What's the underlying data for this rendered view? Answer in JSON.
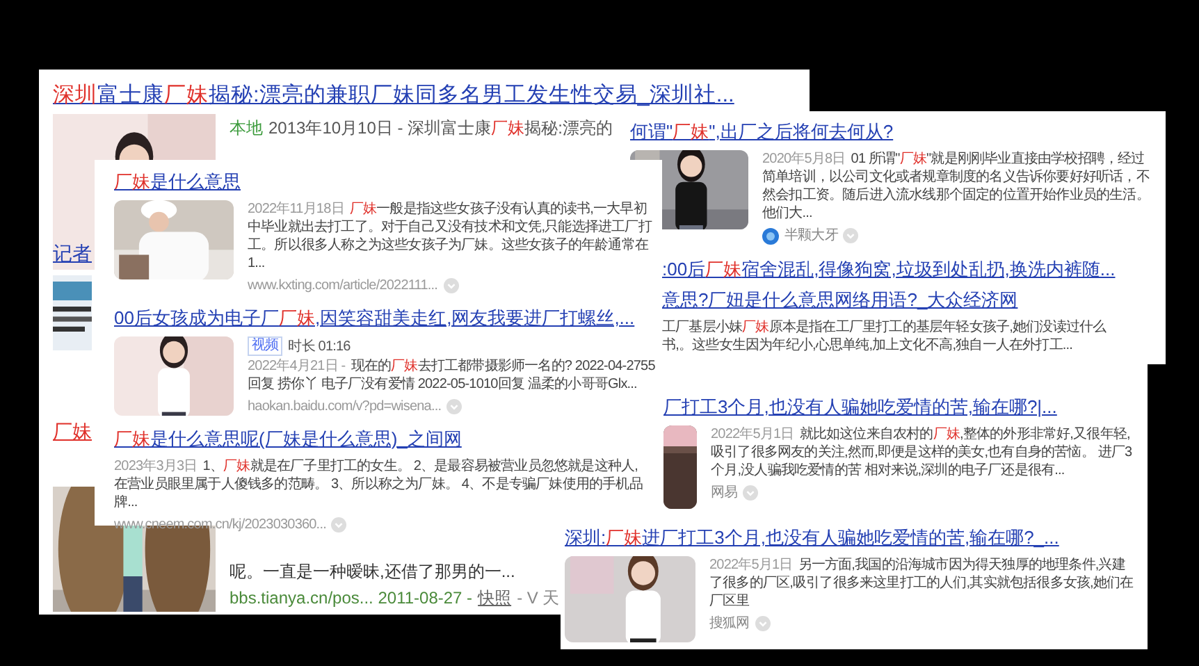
{
  "back_page": {
    "title": [
      {
        "text": "深圳",
        "highlight": true
      },
      {
        "text": "富士康",
        "highlight": false
      },
      {
        "text": "厂妹",
        "highlight": true
      },
      {
        "text": "揭秘:漂亮的兼职厂妹同多名男工发生性交易_深圳社...",
        "highlight": false
      }
    ],
    "thumbnail": {
      "kind": "picture"
    },
    "meta": {
      "tag": "本地",
      "text": [
        {
          "text": "2013年10月10日 - 深圳富士康",
          "highlight": false
        },
        {
          "text": "厂妹",
          "highlight": true
        },
        {
          "text": "揭秘:漂亮的",
          "highlight": false
        }
      ]
    },
    "fragment_1": "记者",
    "side_thumbnail": {
      "kind": "picture"
    },
    "fragment_2": "厂妹",
    "bottom_thumbnail": {
      "kind": "picture"
    },
    "snippet_end": "呢。一直是一种暧昧,还借了那男的一...",
    "footer": {
      "url": "bbs.tianya.cn/pos... 2011-08-27 -",
      "snapshot": "快照",
      "extra": "- V 天"
    }
  },
  "right_page": {
    "results": [
      {
        "title": [
          {
            "text": "何谓\"",
            "highlight": false
          },
          {
            "text": "厂妹",
            "highlight": true
          },
          {
            "text": "\",出厂之后将何去何从?",
            "highlight": false
          }
        ],
        "thumbnail": {
          "kind": "picture"
        },
        "date": "2020年5月8日",
        "snippet": [
          {
            "text": "01 所谓\"",
            "highlight": false
          },
          {
            "text": "厂妹",
            "highlight": true
          },
          {
            "text": "\"就是刚刚毕业直接由学校招聘，经过简单培训，以公司文化或者规章制度的名义告诉你要好好听话，不然会扣工资。随后进入流水线那个固定的位置开始作业员的生活。他们大...",
            "highlight": false
          }
        ],
        "source": "半颗大牙"
      },
      {
        "title": [
          {
            "text": ":00后",
            "highlight": false
          },
          {
            "text": "厂妹",
            "highlight": true
          },
          {
            "text": "宿舍混乱,得像狗窝,垃圾到处乱扔,换洗内裤随...",
            "highlight": false
          }
        ]
      },
      {
        "title": [
          {
            "text": "意思?厂妞是什么意思网络用语?_大众经济网",
            "highlight": false
          }
        ],
        "snippet": [
          {
            "text": "工厂基层小妹",
            "highlight": false
          },
          {
            "text": "厂妹",
            "highlight": true
          },
          {
            "text": "原本是指在工厂里打工的基层年轻女孩子,她们没读过什么书,。这些女生因为年纪小,心思单纯,加上文化不高,独自一人在外打工...",
            "highlight": false
          }
        ]
      }
    ]
  },
  "middle_page": {
    "results": [
      {
        "title": [
          {
            "text": "厂打工3个月,也没有人骗她吃爱情的苦,输在哪?|...",
            "highlight": false
          }
        ],
        "thumbnail": {
          "kind": "picture"
        },
        "date": "2022年5月1日",
        "snippet": [
          {
            "text": "就比如这位来自农村的",
            "highlight": false
          },
          {
            "text": "厂妹",
            "highlight": true
          },
          {
            "text": ",整体的外形非常好,又很年轻,吸引了很多网友的关注,然而,即便是这样的美女,也有自身的苦恼。 进厂3个月,没人骗我吃爱情的苦 相对来说,深圳的电子厂还是很有...",
            "highlight": false
          }
        ],
        "source": "网易"
      }
    ]
  },
  "bottom_page": {
    "results": [
      {
        "title": [
          {
            "text": "深圳:",
            "highlight": false
          },
          {
            "text": "厂妹",
            "highlight": true
          },
          {
            "text": "进厂打工3个月,也没有人骗她吃爱情的苦,输在哪?_...",
            "highlight": false
          }
        ],
        "thumbnail": {
          "kind": "picture"
        },
        "date": "2022年5月1日",
        "snippet": [
          {
            "text": "另一方面,我国的沿海城市因为得天独厚的地理条件,兴建了很多的厂区,吸引了很多来这里打工的人们,其实就包括很多女孩,她们在厂区里",
            "highlight": false
          }
        ],
        "source": "搜狐网"
      }
    ]
  },
  "front_page": {
    "results": [
      {
        "title": [
          {
            "text": "厂妹",
            "highlight": true
          },
          {
            "text": "是什么意思",
            "highlight": false
          }
        ],
        "thumbnail": {
          "kind": "picture"
        },
        "date": "2022年11月18日",
        "snippet": [
          {
            "text": "厂妹",
            "highlight": true
          },
          {
            "text": "一般是指这些女孩子没有认真的读书,一大早初中毕业就出去打工了。对于自己又没有技术和文凭,只能选择进工厂打工。所以很多人称之为这些女孩子为厂妹。这些女孩子的年龄通常在1...",
            "highlight": false
          }
        ],
        "url": "www.kxting.com/article/2022111..."
      },
      {
        "title": [
          {
            "text": "00后女孩成为电子厂",
            "highlight": false
          },
          {
            "text": "厂妹",
            "highlight": true
          },
          {
            "text": ",因笑容甜美走红,网友我要进厂打螺丝,...",
            "highlight": false
          }
        ],
        "thumbnail": {
          "kind": "picture"
        },
        "badge": "视频",
        "duration": "时长 01:16",
        "date": "2022年4月21日 -",
        "snippet": [
          {
            "text": "现在的",
            "highlight": false
          },
          {
            "text": "厂妹",
            "highlight": true
          },
          {
            "text": "去打工都带摄影师一名的? 2022-04-2755回复 捞你丫 电子厂没有爱情 2022-05-1010回复 温柔的小哥哥Glx...",
            "highlight": false
          }
        ],
        "url": "haokan.baidu.com/v?pd=wisena..."
      },
      {
        "title": [
          {
            "text": "厂妹",
            "highlight": true
          },
          {
            "text": "是什么意思呢(厂妹是什么意思)_之间网",
            "highlight": false
          }
        ],
        "date": "2023年3月3日",
        "snippet": [
          {
            "text": "1、",
            "highlight": false
          },
          {
            "text": "厂妹",
            "highlight": true
          },
          {
            "text": "就是在厂子里打工的女生。 2、是最容易被营业员忽悠就是这种人,在营业员眼里属于人傻钱多的范畴。 3、所以称之为厂妹。 4、不是专骗厂妹使用的手机品牌...",
            "highlight": false
          }
        ],
        "url": "www.cneem.com.cn/kj/2023030360..."
      }
    ]
  }
}
